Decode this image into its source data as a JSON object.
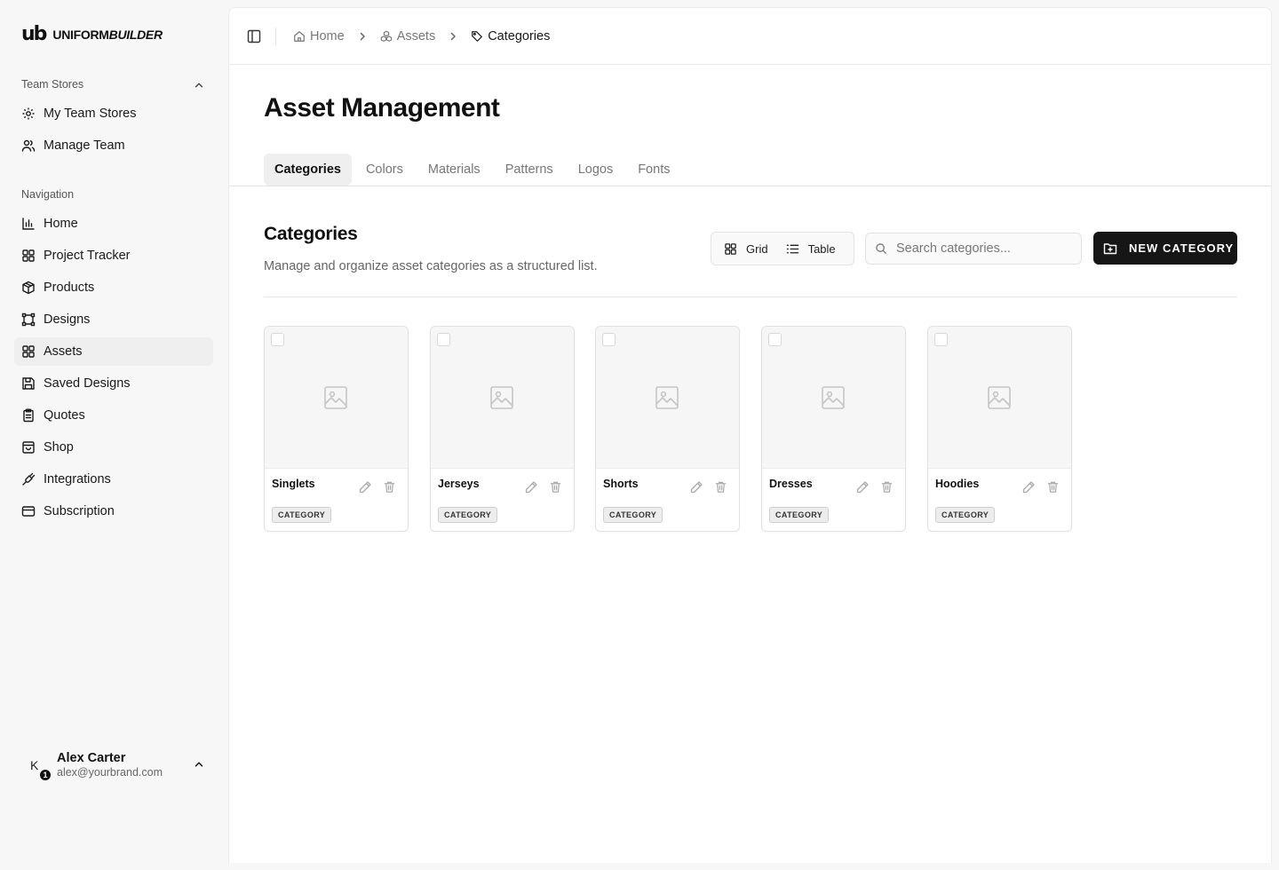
{
  "brand": {
    "mark": "ub",
    "name_regular": "UNIFORM",
    "name_bold": "BUILDER"
  },
  "sidebar": {
    "team_section": {
      "label": "Team Stores",
      "items": [
        {
          "label": "My Team Stores",
          "icon": "gear-icon"
        },
        {
          "label": "Manage Team",
          "icon": "users-icon"
        }
      ]
    },
    "nav_section": {
      "label": "Navigation",
      "items": [
        {
          "label": "Home",
          "icon": "bar-chart-icon"
        },
        {
          "label": "Project Tracker",
          "icon": "grid-icon"
        },
        {
          "label": "Products",
          "icon": "package-icon"
        },
        {
          "label": "Designs",
          "icon": "vector-icon"
        },
        {
          "label": "Assets",
          "icon": "grid-icon",
          "active": true
        },
        {
          "label": "Saved Designs",
          "icon": "save-icon"
        },
        {
          "label": "Quotes",
          "icon": "clipboard-icon"
        },
        {
          "label": "Shop",
          "icon": "shopping-bag-icon"
        },
        {
          "label": "Integrations",
          "icon": "plug-icon"
        },
        {
          "label": "Subscription",
          "icon": "credit-card-icon"
        }
      ]
    }
  },
  "user": {
    "initial": "K",
    "badge": "1",
    "name": "Alex Carter",
    "email": "alex@yourbrand.com"
  },
  "breadcrumb": {
    "home": "Home",
    "assets": "Assets",
    "current": "Categories"
  },
  "page": {
    "title": "Asset Management",
    "tabs": [
      "Categories",
      "Colors",
      "Materials",
      "Patterns",
      "Logos",
      "Fonts"
    ],
    "active_tab": "Categories"
  },
  "section": {
    "title": "Categories",
    "description": "Manage and organize asset categories as a structured list.",
    "view_grid": "Grid",
    "view_table": "Table",
    "search_placeholder": "Search categories...",
    "new_button": "NEW CATEGORY"
  },
  "cards": [
    {
      "name": "Singlets",
      "badge": "CATEGORY"
    },
    {
      "name": "Jerseys",
      "badge": "CATEGORY"
    },
    {
      "name": "Shorts",
      "badge": "CATEGORY"
    },
    {
      "name": "Dresses",
      "badge": "CATEGORY"
    },
    {
      "name": "Hoodies",
      "badge": "CATEGORY"
    }
  ],
  "colors": {
    "primary": "#161616",
    "sidebar_bg": "#f7f7f7",
    "active_tab_bg": "#efefef"
  }
}
